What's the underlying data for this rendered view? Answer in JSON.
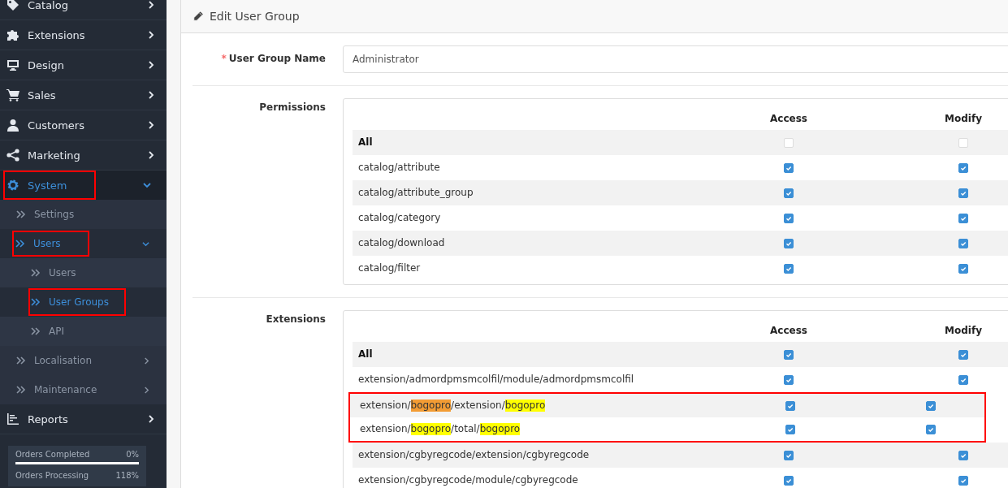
{
  "sidebar": {
    "items": [
      {
        "label": "Catalog",
        "kind": "folder",
        "selected": false,
        "expanded": false,
        "annotated": false
      },
      {
        "label": "Extensions",
        "kind": "folder",
        "selected": false,
        "expanded": false,
        "annotated": false
      },
      {
        "label": "Design",
        "kind": "folder",
        "selected": false,
        "expanded": false,
        "annotated": false
      },
      {
        "label": "Sales",
        "kind": "folder",
        "selected": false,
        "expanded": false,
        "annotated": false
      },
      {
        "label": "Customers",
        "kind": "folder",
        "selected": false,
        "expanded": false,
        "annotated": false
      },
      {
        "label": "Marketing",
        "kind": "folder",
        "selected": false,
        "expanded": false,
        "annotated": false
      },
      {
        "label": "System",
        "kind": "folder",
        "selected": true,
        "expanded": true,
        "annotated": true,
        "children": [
          {
            "label": "Settings",
            "kind": "link",
            "selected": false,
            "annotated": false
          },
          {
            "label": "Users",
            "kind": "folder",
            "selected": true,
            "expanded": true,
            "annotated": true,
            "children": [
              {
                "label": "Users",
                "kind": "link",
                "selected": false,
                "annotated": false
              },
              {
                "label": "User Groups",
                "kind": "link",
                "selected": true,
                "annotated": true
              },
              {
                "label": "API",
                "kind": "link",
                "selected": false,
                "annotated": false
              }
            ]
          },
          {
            "label": "Localisation",
            "kind": "folder",
            "selected": false,
            "expanded": false,
            "annotated": false
          },
          {
            "label": "Maintenance",
            "kind": "folder",
            "selected": false,
            "expanded": false,
            "annotated": false
          }
        ]
      },
      {
        "label": "Reports",
        "kind": "folder",
        "selected": false,
        "expanded": false,
        "annotated": false
      }
    ],
    "stats": [
      {
        "label": "Orders Completed",
        "value": "0%",
        "level": 1
      },
      {
        "label": "Orders Processing",
        "value": "118%"
      }
    ]
  },
  "panel": {
    "title": "Edit User Group",
    "name_field": {
      "label": "User Group Name",
      "required_mark": "*",
      "value": "Administrator"
    },
    "sections": [
      {
        "label": "Permissions",
        "columns": [
          "Access",
          "Modify"
        ],
        "rows": [
          {
            "name": [
              {
                "text": "All"
              }
            ],
            "bold": true,
            "access": false,
            "modify": false,
            "annotated": false
          },
          {
            "name": [
              {
                "text": "catalog/attribute"
              }
            ],
            "bold": false,
            "access": true,
            "modify": true,
            "annotated": false
          },
          {
            "name": [
              {
                "text": "catalog/attribute_group"
              }
            ],
            "bold": false,
            "access": true,
            "modify": true,
            "annotated": false
          },
          {
            "name": [
              {
                "text": "catalog/category"
              }
            ],
            "bold": false,
            "access": true,
            "modify": true,
            "annotated": false
          },
          {
            "name": [
              {
                "text": "catalog/download"
              }
            ],
            "bold": false,
            "access": true,
            "modify": true,
            "annotated": false
          },
          {
            "name": [
              {
                "text": "catalog/filter"
              }
            ],
            "bold": false,
            "access": true,
            "modify": true,
            "annotated": false
          }
        ]
      },
      {
        "label": "Extensions",
        "columns": [
          "Access",
          "Modify"
        ],
        "rows": [
          {
            "name": [
              {
                "text": "All"
              }
            ],
            "bold": true,
            "access": true,
            "modify": true,
            "annotated": false
          },
          {
            "name": [
              {
                "text": "extension/admordpmsmcolfil/module/admordpmsmcolfil"
              }
            ],
            "bold": false,
            "access": true,
            "modify": true,
            "annotated": false
          },
          {
            "name": [
              {
                "text": "extension/"
              },
              {
                "text": "bogopro",
                "color": "#f39c34"
              },
              {
                "text": "/extension/"
              },
              {
                "text": "bogopro",
                "color": "#ffff00"
              }
            ],
            "bold": false,
            "access": true,
            "modify": true,
            "annotated": true
          },
          {
            "name": [
              {
                "text": "extension/"
              },
              {
                "text": "bogopro",
                "color": "#ffff00"
              },
              {
                "text": "/total/"
              },
              {
                "text": "bogopro",
                "color": "#ffff00"
              }
            ],
            "bold": false,
            "access": true,
            "modify": true,
            "annotated": true
          },
          {
            "name": [
              {
                "text": "extension/cgbyregcode/extension/cgbyregcode"
              }
            ],
            "bold": false,
            "access": true,
            "modify": true,
            "annotated": false
          },
          {
            "name": [
              {
                "text": "extension/cgbyregcode/module/cgbyregcode"
              }
            ],
            "bold": false,
            "access": true,
            "modify": true,
            "annotated": false
          }
        ]
      }
    ]
  }
}
